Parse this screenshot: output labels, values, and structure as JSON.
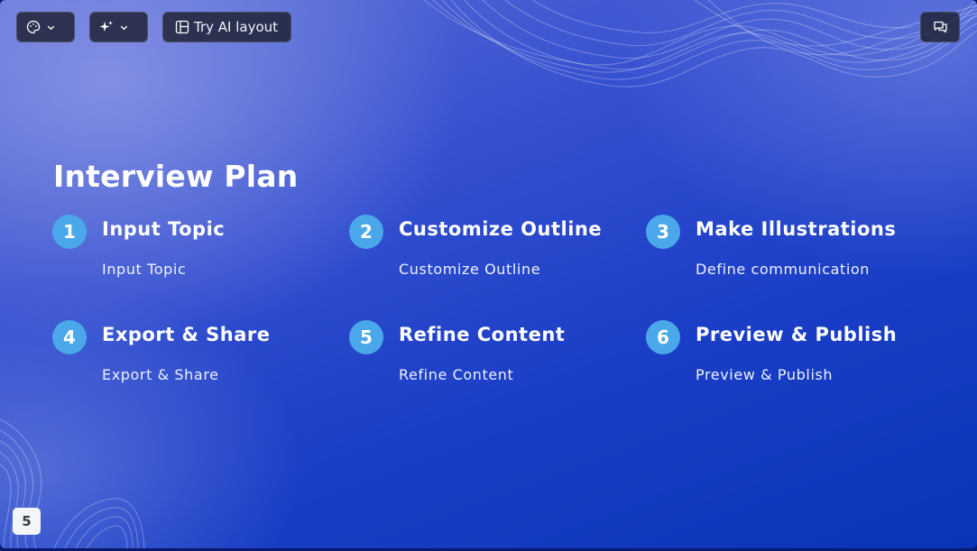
{
  "toolbar": {
    "theme_icon": "palette-icon",
    "ai_icon": "sparkles-icon",
    "layout_icon": "layout-icon",
    "layout_label": "Try AI layout",
    "comment_icon": "comments-icon",
    "dropdown_icon": "chevron-down-icon"
  },
  "slide": {
    "title": "Interview Plan",
    "steps": [
      {
        "number": "1",
        "title": "Input Topic",
        "description": "Input Topic"
      },
      {
        "number": "2",
        "title": "Customize Outline",
        "description": "Customize Outline"
      },
      {
        "number": "3",
        "title": "Make Illustrations",
        "description": "Define communication"
      },
      {
        "number": "4",
        "title": "Export & Share",
        "description": "Export & Share"
      },
      {
        "number": "5",
        "title": "Refine Content",
        "description": "Refine Content"
      },
      {
        "number": "6",
        "title": "Preview & Publish",
        "description": "Preview & Publish"
      }
    ]
  },
  "page_number": "5",
  "colors": {
    "badge": "#4aa8ea",
    "background_start": "#5b6fd6",
    "background_end": "#0a35b8",
    "toolbar_button": "#1c2030"
  }
}
